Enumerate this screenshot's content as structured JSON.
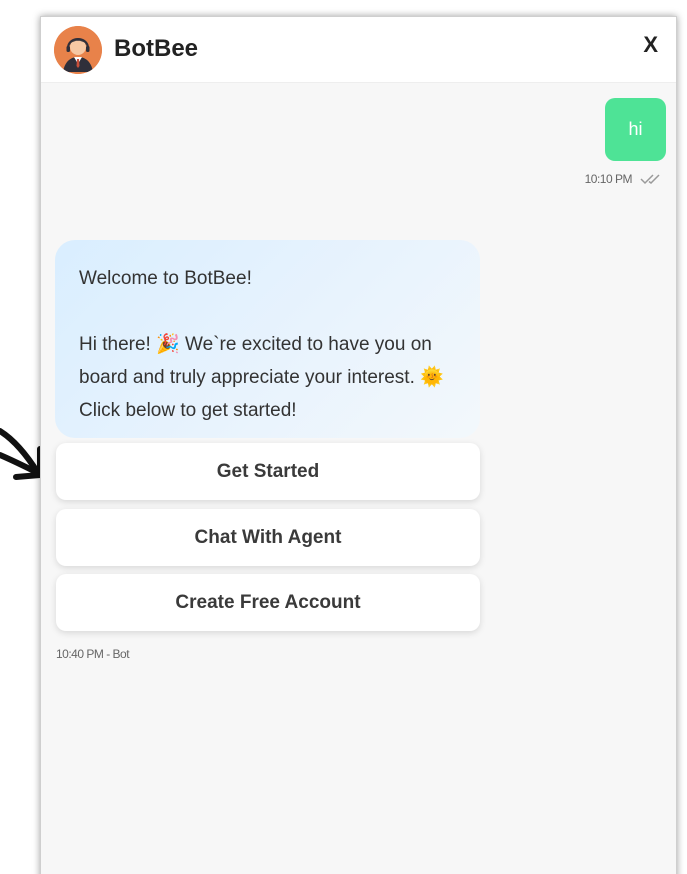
{
  "header": {
    "bot_name": "BotBee",
    "close_label": "X",
    "avatar_icon": "agent-avatar-icon"
  },
  "messages": {
    "user": {
      "text": "hi",
      "time": "10:10 PM",
      "status_icon": "double-check-icon"
    },
    "bot": {
      "welcome": "Welcome to BotBee!",
      "body_before_party": "Hi there! ",
      "party_icon": "🎉",
      "body_middle": " We`re excited to have you on board and truly appreciate your interest. ",
      "sun_icon": "🌞",
      "body_after_sun": " Click below to get started!",
      "meta": "10:40 PM - Bot"
    }
  },
  "actions": [
    {
      "label": "Get Started"
    },
    {
      "label": "Chat With Agent"
    },
    {
      "label": "Create Free Account"
    }
  ],
  "colors": {
    "user_bubble": "#4ee396",
    "avatar_bg": "#e8824a",
    "bot_bubble": "#e3f1fd",
    "window_bg": "#f7f7f7"
  }
}
